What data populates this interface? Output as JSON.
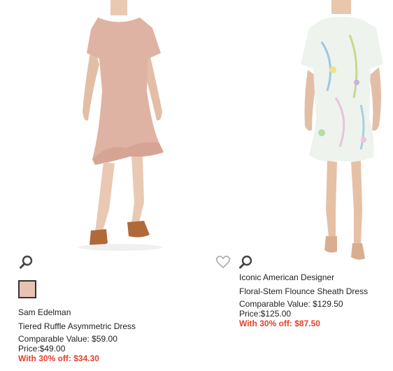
{
  "colors": {
    "sale_text": "#e2412a",
    "swatch_blush": "#e8c3b3",
    "icon_gray": "#444444",
    "heart_gray": "#b0b0b0"
  },
  "products": [
    {
      "brand": "Sam Edelman",
      "name": "Tiered Ruffle Asymmetric Dress",
      "comparable": "Comparable Value: $59.00",
      "price": "Price:$49.00",
      "sale": "With 30% off: $34.30",
      "swatch_color": "blush",
      "icons": [
        "search-icon"
      ]
    },
    {
      "brand": "Iconic American Designer",
      "name": "Floral-Stem Flounce Sheath Dress",
      "comparable": "Comparable Value: $129.50",
      "price": "Price:$125.00",
      "sale": "With 30% off: $87.50",
      "icons": [
        "heart-icon",
        "search-icon"
      ]
    }
  ]
}
